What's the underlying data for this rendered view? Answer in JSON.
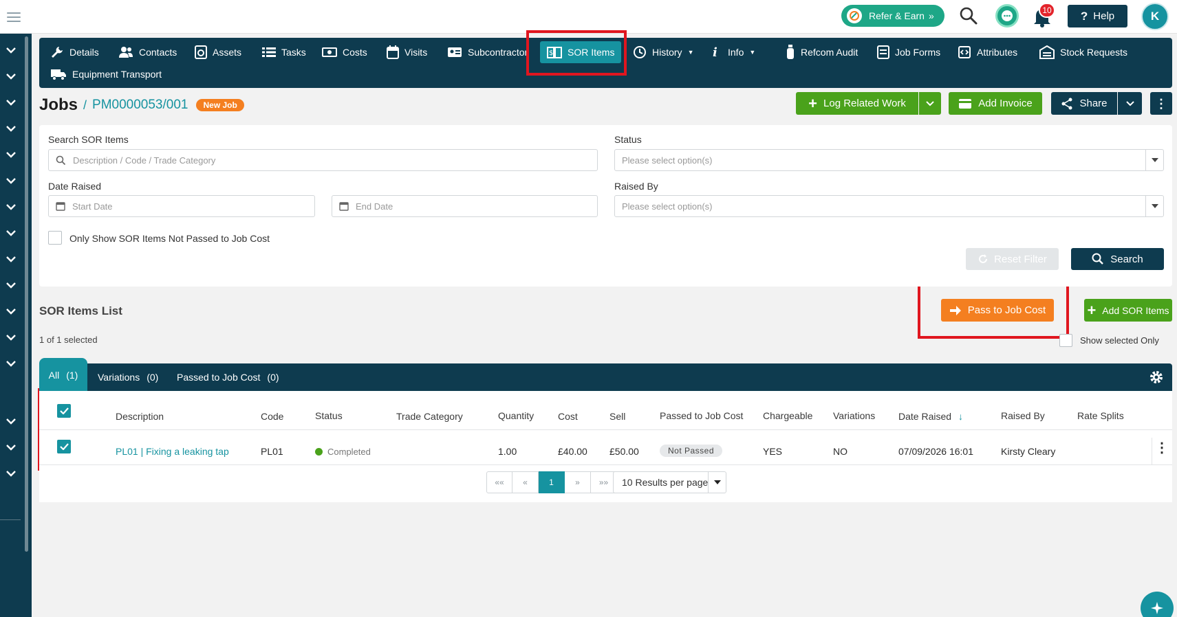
{
  "topbar": {
    "refer_label": "Refer & Earn",
    "notification_count": "10",
    "help_label": "Help",
    "avatar_initial": "K"
  },
  "nav": {
    "items": [
      {
        "label": "Details",
        "icon": "wrench-icon"
      },
      {
        "label": "Contacts",
        "icon": "contacts-icon"
      },
      {
        "label": "Assets",
        "icon": "assets-icon"
      },
      {
        "label": "Tasks",
        "icon": "tasks-icon"
      },
      {
        "label": "Costs",
        "icon": "costs-icon"
      },
      {
        "label": "Visits",
        "icon": "calendar-icon"
      },
      {
        "label": "Subcontractor",
        "icon": "id-card-icon"
      },
      {
        "label": "SOR Items",
        "icon": "book-icon"
      },
      {
        "label": "History",
        "icon": "history-icon"
      },
      {
        "label": "Info",
        "icon": "info-icon"
      },
      {
        "label": "Refcom Audit",
        "icon": "bottle-icon"
      },
      {
        "label": "Job Forms",
        "icon": "form-icon"
      },
      {
        "label": "Attributes",
        "icon": "attributes-icon"
      },
      {
        "label": "Stock Requests",
        "icon": "warehouse-icon"
      },
      {
        "label": "Equipment Transport",
        "icon": "truck-icon"
      }
    ],
    "active": "SOR Items"
  },
  "header": {
    "title": "Jobs",
    "separator": "/",
    "job_code": "PM0000053/001",
    "status_badge": "New Job",
    "log_related_work": "Log Related Work",
    "add_invoice": "Add Invoice",
    "share": "Share"
  },
  "filters": {
    "search_label": "Search SOR Items",
    "search_placeholder": "Description / Code / Trade Category",
    "status_label": "Status",
    "status_placeholder": "Please select option(s)",
    "date_raised_label": "Date Raised",
    "start_date_placeholder": "Start Date",
    "end_date_placeholder": "End Date",
    "raised_by_label": "Raised By",
    "raised_by_placeholder": "Please select option(s)",
    "only_not_passed_label": "Only Show SOR Items Not Passed to Job Cost",
    "reset_label": "Reset Filter",
    "search_button": "Search"
  },
  "list": {
    "title": "SOR Items List",
    "selected_text": "1 of 1 selected",
    "pass_to_job_cost": "Pass to Job Cost",
    "add_sor_items": "Add SOR Items",
    "show_selected_only": "Show selected Only",
    "tabs": [
      {
        "label": "All",
        "count": "(1)"
      },
      {
        "label": "Variations",
        "count": "(0)"
      },
      {
        "label": "Passed to Job Cost",
        "count": "(0)"
      }
    ],
    "columns": [
      "Description",
      "Code",
      "Status",
      "Trade Category",
      "Quantity",
      "Cost",
      "Sell",
      "Passed to Job Cost",
      "Chargeable",
      "Variations",
      "Date Raised",
      "Raised By",
      "Rate Splits"
    ],
    "rows": [
      {
        "description": "PL01 | Fixing a leaking tap",
        "code": "PL01",
        "status": "Completed",
        "trade_category": "",
        "quantity": "1.00",
        "cost": "£40.00",
        "sell": "£50.00",
        "passed": "Not Passed",
        "chargeable": "YES",
        "variations": "NO",
        "date_raised": "07/09/2026 16:01",
        "raised_by": "Kirsty Cleary",
        "rate_splits": ""
      }
    ]
  },
  "pagination": {
    "first": "««",
    "prev": "«",
    "current": "1",
    "next": "»",
    "last": "»»",
    "per_page": "10 Results per page"
  },
  "colors": {
    "navy": "#0e3b4f",
    "teal": "#1693a0",
    "green": "#4aa21b",
    "orange": "#f47f20",
    "highlight_red": "#e0161f"
  }
}
